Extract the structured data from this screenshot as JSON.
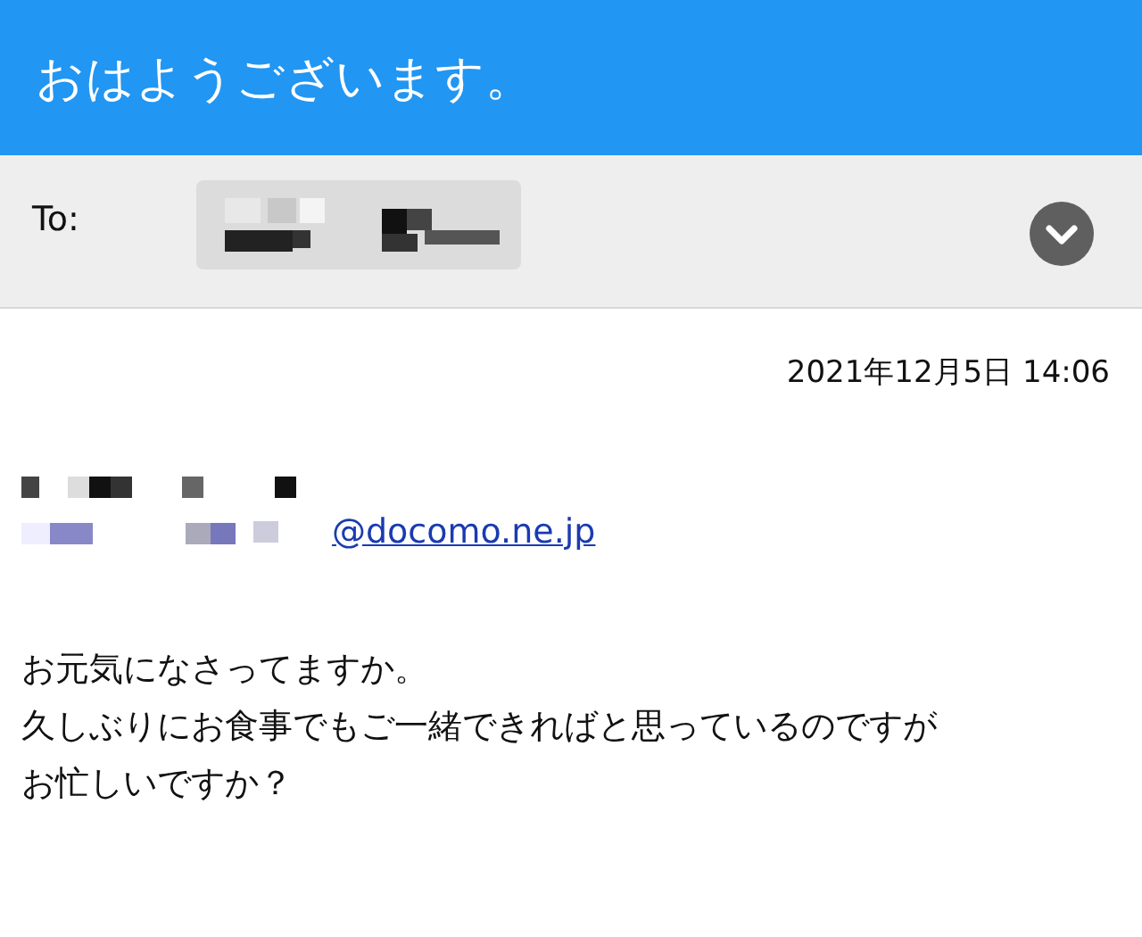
{
  "header": {
    "title": "おはようございます。"
  },
  "recipient": {
    "label": "To:"
  },
  "message": {
    "date": "2021年12月5日 14:06",
    "sender_address": "@docomo.ne.jp",
    "body": [
      "お元気になさってますか。",
      "久しぶりにお食事でもご一緒できればと思っているのですが",
      "お忙しいですか？"
    ]
  }
}
